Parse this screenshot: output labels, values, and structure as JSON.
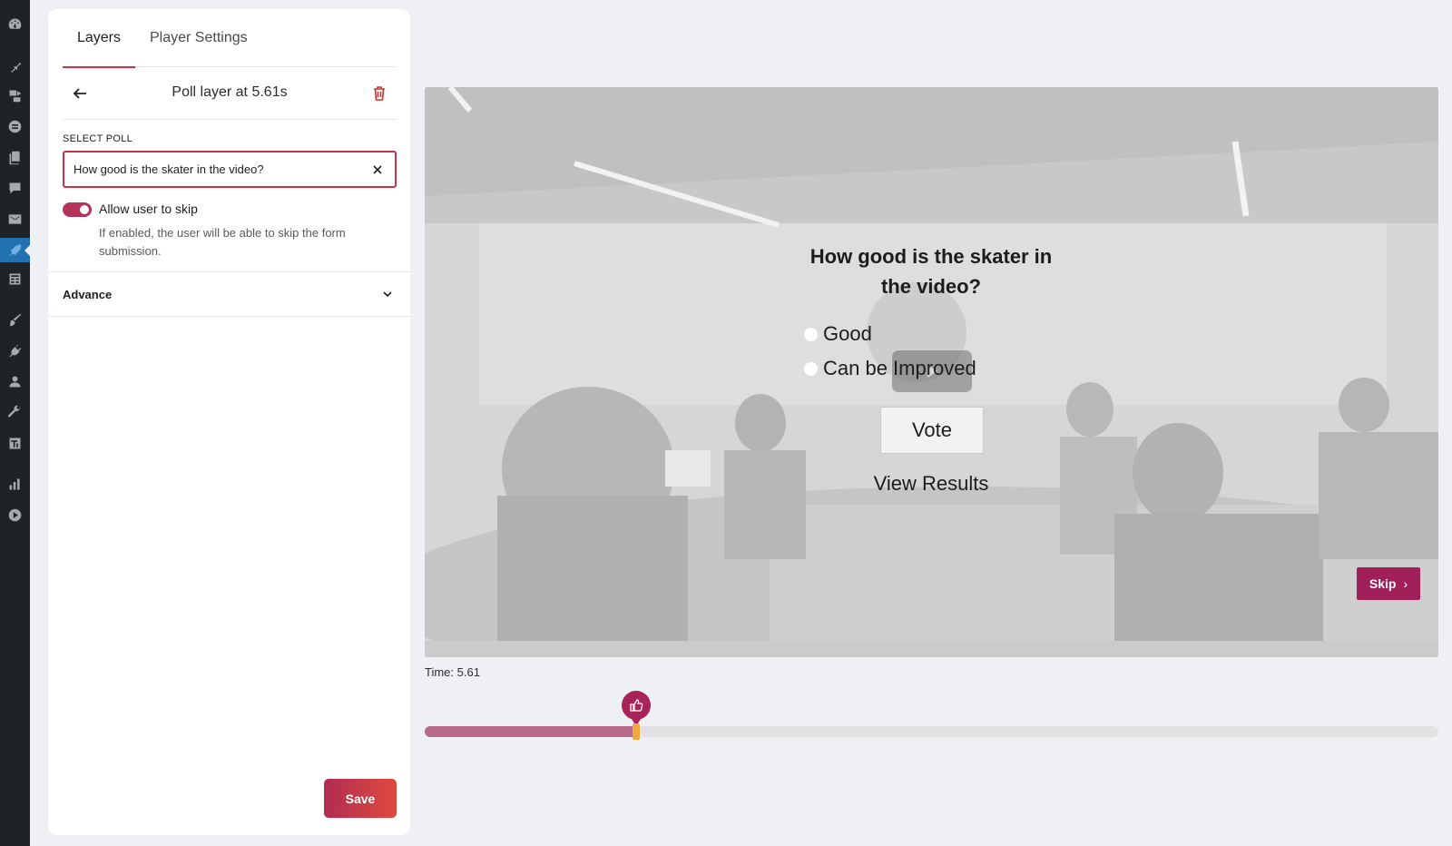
{
  "wp_sidebar": {
    "icons": [
      "dashboard-icon",
      "pin-icon",
      "media-icon",
      "widgets-icon",
      "pages-icon",
      "comments-icon",
      "mail-icon",
      "rocket-icon",
      "forms-icon",
      "brush-icon",
      "plugins-icon",
      "users-icon",
      "tools-icon",
      "settings-icon",
      "analytics-icon",
      "play-icon"
    ],
    "active_icon": "rocket-icon",
    "active_color": "#2271b1"
  },
  "panel": {
    "tabs": [
      {
        "label": "Layers",
        "active": true
      },
      {
        "label": "Player Settings",
        "active": false
      }
    ],
    "layer_title": "Poll layer at 5.61s",
    "select_poll": {
      "label": "Select Poll",
      "value": "How good is the skater in the video?"
    },
    "allow_skip": {
      "label": "Allow user to skip",
      "enabled": true,
      "help": "If enabled, the user will be able to skip the form submission."
    },
    "advance_label": "Advance",
    "save_label": "Save"
  },
  "video": {
    "poll_question": "How good is the skater in the video?",
    "options": [
      "Good",
      "Can be Improved"
    ],
    "vote_label": "Vote",
    "view_results_label": "View Results",
    "skip_label": "Skip"
  },
  "time_readout": "Time: 5.61",
  "timeline": {
    "progress_fraction": 0.209,
    "marker_icon": "thumbs-up-icon"
  },
  "colors": {
    "accent": "#c93247",
    "toggle": "#b5335a",
    "skip": "#a01f58",
    "timeline_fill": "#b86a8a",
    "timeline_handle": "#f0a93e"
  }
}
